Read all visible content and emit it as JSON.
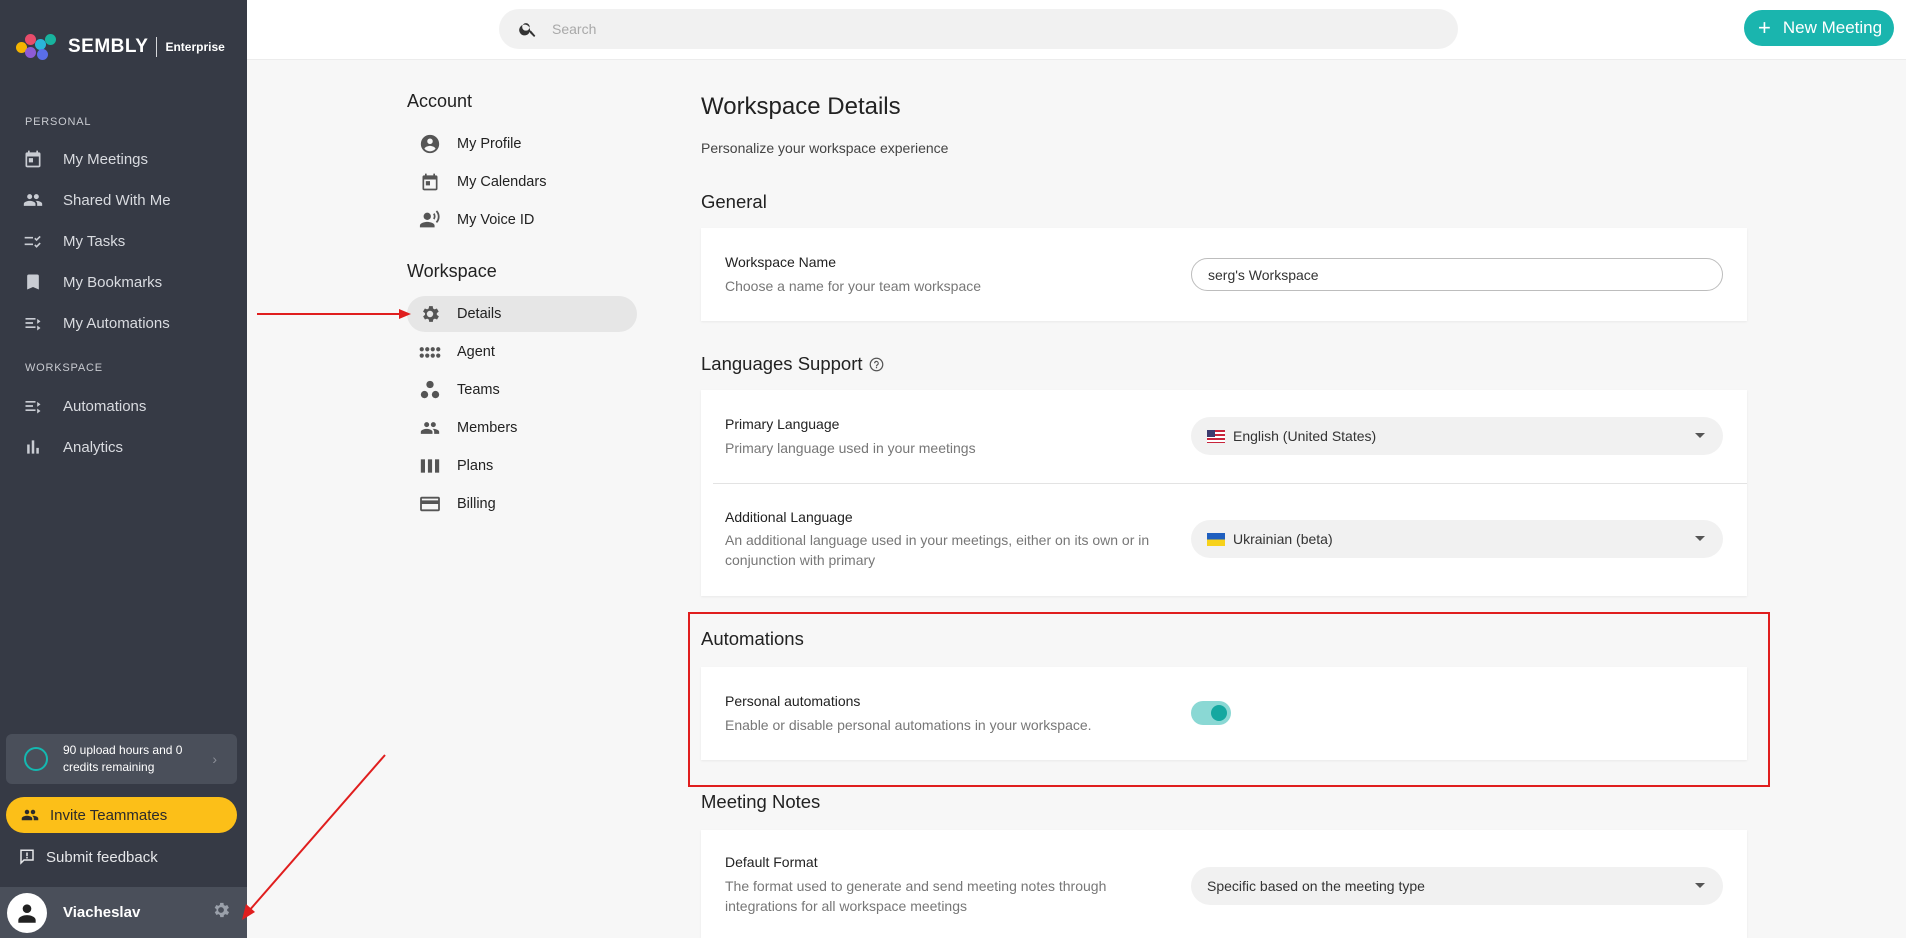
{
  "app": {
    "brand": "SEMBLY",
    "edition": "Enterprise"
  },
  "sidebar": {
    "personal_label": "PERSONAL",
    "workspace_label": "WORKSPACE",
    "personal_items": [
      {
        "label": "My Meetings",
        "icon": "calendar-icon"
      },
      {
        "label": "Shared With Me",
        "icon": "people-icon"
      },
      {
        "label": "My Tasks",
        "icon": "tasks-icon"
      },
      {
        "label": "My Bookmarks",
        "icon": "bookmark-icon"
      },
      {
        "label": "My Automations",
        "icon": "automation-icon"
      }
    ],
    "workspace_items": [
      {
        "label": "Automations",
        "icon": "automation-icon"
      },
      {
        "label": "Analytics",
        "icon": "bar-chart-icon"
      }
    ],
    "credits_text": "90 upload hours and 0 credits remaining",
    "invite_label": "Invite Teammates",
    "feedback_label": "Submit feedback",
    "user_name": "Viacheslav"
  },
  "topbar": {
    "search_placeholder": "Search",
    "new_meeting_label": "New Meeting"
  },
  "settings_menu": {
    "account_heading": "Account",
    "account_items": [
      {
        "label": "My Profile",
        "icon": "account-circle-icon"
      },
      {
        "label": "My Calendars",
        "icon": "calendar-icon"
      },
      {
        "label": "My Voice ID",
        "icon": "voice-id-icon"
      }
    ],
    "workspace_heading": "Workspace",
    "workspace_items": [
      {
        "label": "Details",
        "icon": "gear-icon",
        "active": true
      },
      {
        "label": "Agent",
        "icon": "agent-icon"
      },
      {
        "label": "Teams",
        "icon": "teams-icon"
      },
      {
        "label": "Members",
        "icon": "members-icon"
      },
      {
        "label": "Plans",
        "icon": "plans-icon"
      },
      {
        "label": "Billing",
        "icon": "credit-card-icon"
      }
    ]
  },
  "main": {
    "title": "Workspace Details",
    "subtitle": "Personalize your workspace experience",
    "general": {
      "heading": "General",
      "workspace_name_label": "Workspace Name",
      "workspace_name_desc": "Choose a name for your team workspace",
      "workspace_name_value": "serg's Workspace"
    },
    "languages": {
      "heading": "Languages Support",
      "primary_label": "Primary Language",
      "primary_desc": "Primary language used in your meetings",
      "primary_value": "English (United States)",
      "additional_label": "Additional Language",
      "additional_desc": "An additional language used in your meetings, either on its own or in conjunction with primary",
      "additional_value": "Ukrainian (beta)"
    },
    "automations": {
      "heading": "Automations",
      "personal_label": "Personal automations",
      "personal_desc": "Enable or disable personal automations in your workspace.",
      "enabled": true
    },
    "meeting_notes": {
      "heading": "Meeting Notes",
      "default_format_label": "Default Format",
      "default_format_desc": "The format used to generate and send meeting notes through integrations for all workspace meetings",
      "default_format_value": "Specific based on the meeting type"
    }
  },
  "colors": {
    "sidebar_bg": "#363a45",
    "accent": "#1ab5ae",
    "invite_bg": "#fcbf18",
    "annotation": "#e01e1e"
  }
}
